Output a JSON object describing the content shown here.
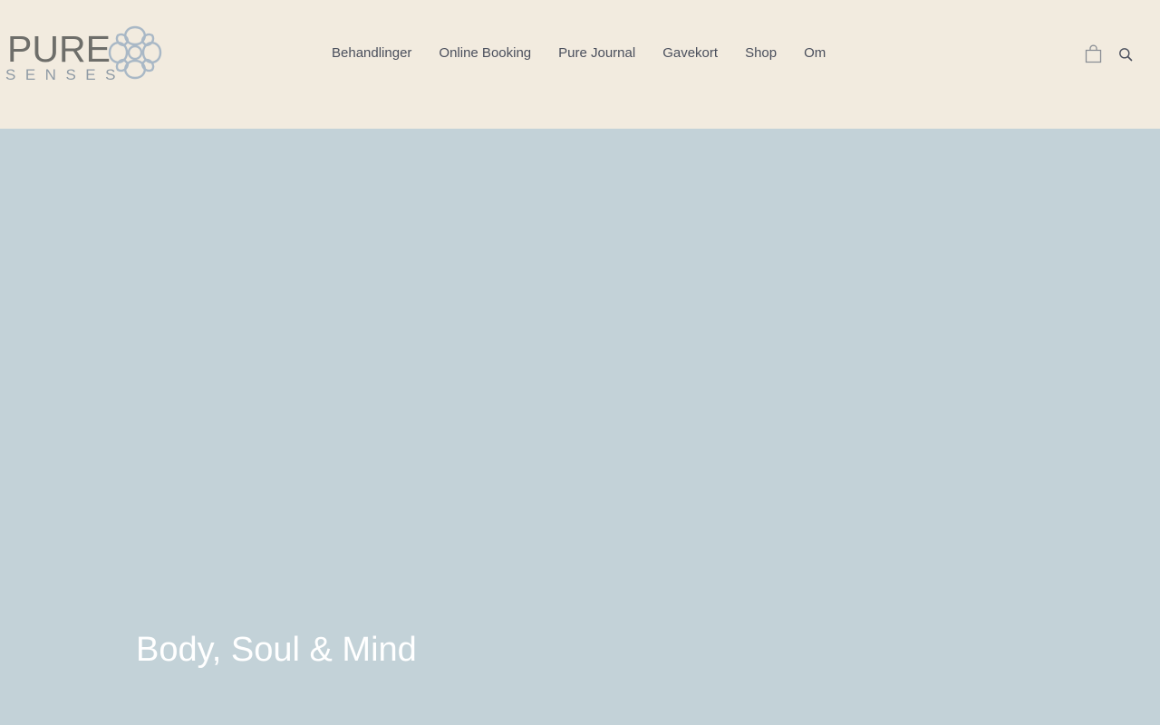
{
  "brand": {
    "name": "PURE",
    "tagline": "SENSES",
    "mark_icon": "flower-ornament-icon"
  },
  "nav": {
    "items": [
      {
        "label": "Behandlinger"
      },
      {
        "label": "Online Booking"
      },
      {
        "label": "Pure Journal"
      },
      {
        "label": "Gavekort"
      },
      {
        "label": "Shop"
      },
      {
        "label": "Om"
      }
    ]
  },
  "header_actions": {
    "cart_icon": "shopping-bag-icon",
    "search_icon": "search-icon"
  },
  "hero": {
    "title": "Body, Soul & Mind"
  },
  "colors": {
    "header_bg": "#F2EBDF",
    "hero_bg": "#C3D2D8",
    "nav_text": "#4A4F5C",
    "logo_text": "#6E6E6A",
    "logo_accent": "#A9B8C6",
    "hero_text": "#FFFFFF"
  }
}
